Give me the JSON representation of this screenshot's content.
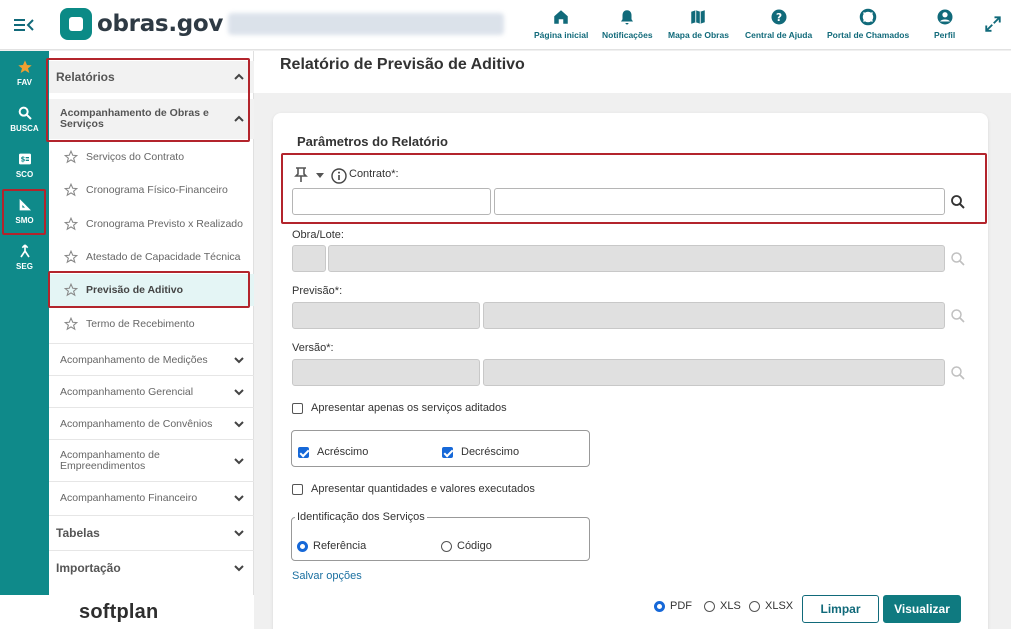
{
  "header": {
    "logo_text": "obras.gov",
    "nav": [
      {
        "label": "Página inicial",
        "icon": "home-icon"
      },
      {
        "label": "Notificações",
        "icon": "bell-icon"
      },
      {
        "label": "Mapa de Obras",
        "icon": "map-icon"
      },
      {
        "label": "Central de Ajuda",
        "icon": "help-icon"
      },
      {
        "label": "Portal de Chamados",
        "icon": "lifebuoy-icon"
      },
      {
        "label": "Perfil",
        "icon": "user-icon"
      }
    ],
    "accent": "#116a7a"
  },
  "rail": {
    "items": [
      {
        "label": "FAV",
        "icon": "star-icon"
      },
      {
        "label": "BUSCA",
        "icon": "search-icon"
      },
      {
        "label": "SCO",
        "icon": "dollar-doc-icon"
      },
      {
        "label": "SMO",
        "icon": "ruler-triangle-icon"
      },
      {
        "label": "SEG",
        "icon": "merge-icon"
      }
    ],
    "color": "#0f8a8a"
  },
  "sidebar": {
    "section_relatorios": "Relatórios",
    "group_acompanhamento_obras": "Acompanhamento de Obras e Serviços",
    "leaves": [
      "Serviços do Contrato",
      "Cronograma Físico-Financeiro",
      "Cronograma Previsto x Realizado",
      "Atestado de Capacidade Técnica",
      "Previsão de Aditivo",
      "Termo de Recebimento"
    ],
    "groups": [
      "Acompanhamento de Medições",
      "Acompanhamento Gerencial",
      "Acompanhamento de Convênios",
      "Acompanhamento de Empreendimentos",
      "Acompanhamento Financeiro"
    ],
    "section_tabelas": "Tabelas",
    "section_importacao": "Importação",
    "footer_brand": "softplan"
  },
  "main": {
    "title": "Relatório de Previsão de Aditivo",
    "card_title": "Parâmetros do Relatório",
    "contrato_label": "Contrato*:",
    "obra_label": "Obra/Lote:",
    "previsao_label": "Previsão*:",
    "versao_label": "Versão*:",
    "apenas_aditados": "Apresentar apenas os serviços aditados",
    "acrescimo": "Acréscimo",
    "decrescimo": "Decréscimo",
    "quantidades": "Apresentar quantidades e valores executados",
    "identificacao_legend": "Identificação dos Serviços",
    "referencia": "Referência",
    "codigo": "Código",
    "salvar_opcoes": "Salvar opções",
    "formats": [
      "PDF",
      "XLS",
      "XLSX"
    ],
    "selected_format": "PDF",
    "limpar": "Limpar",
    "visualizar": "Visualizar"
  }
}
